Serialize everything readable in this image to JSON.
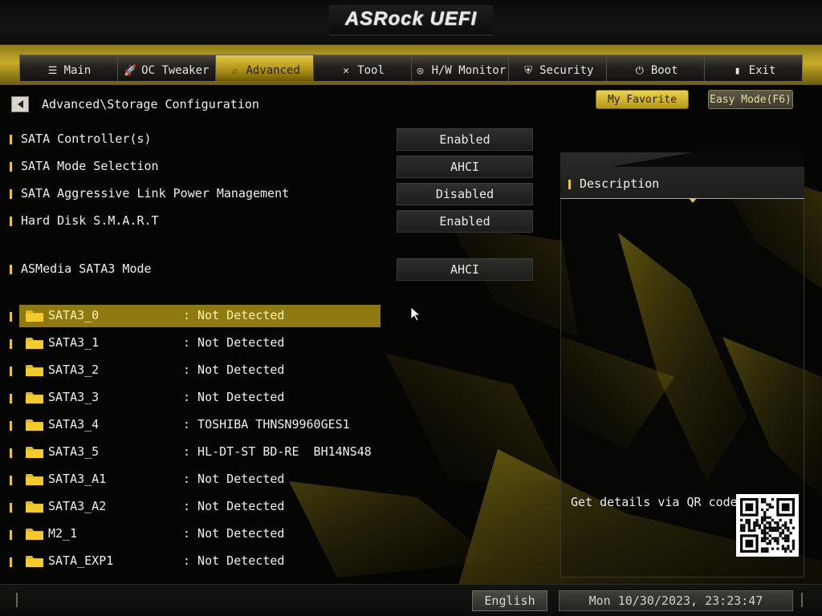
{
  "app": {
    "logo_text": "ASRock UEFI"
  },
  "tabs": [
    {
      "label": "Main",
      "icon": "list-icon",
      "active": false
    },
    {
      "label": "OC Tweaker",
      "icon": "rocket-icon",
      "active": false
    },
    {
      "label": "Advanced",
      "icon": "star-icon",
      "active": true
    },
    {
      "label": "Tool",
      "icon": "tools-icon",
      "active": false
    },
    {
      "label": "H/W Monitor",
      "icon": "monitor-icon",
      "active": false
    },
    {
      "label": "Security",
      "icon": "shield-icon",
      "active": false
    },
    {
      "label": "Boot",
      "icon": "power-icon",
      "active": false
    },
    {
      "label": "Exit",
      "icon": "exit-door-icon",
      "active": false
    }
  ],
  "breadcrumb": "Advanced\\Storage Configuration",
  "buttons": {
    "my_favorite": "My Favorite",
    "easy_mode": "Easy Mode(F6)"
  },
  "settings": [
    {
      "label": "SATA Controller(s)",
      "value": "Enabled"
    },
    {
      "label": "SATA Mode Selection",
      "value": "AHCI"
    },
    {
      "label": "SATA Aggressive Link Power Management",
      "value": "Disabled"
    },
    {
      "label": "Hard Disk S.M.A.R.T",
      "value": "Enabled"
    },
    {
      "label": "ASMedia SATA3 Mode",
      "value": "AHCI"
    }
  ],
  "devices": [
    {
      "name": "SATA3_0",
      "value": ": Not Detected",
      "selected": true
    },
    {
      "name": "SATA3_1",
      "value": ": Not Detected",
      "selected": false
    },
    {
      "name": "SATA3_2",
      "value": ": Not Detected",
      "selected": false
    },
    {
      "name": "SATA3_3",
      "value": ": Not Detected",
      "selected": false
    },
    {
      "name": "SATA3_4",
      "value": ": TOSHIBA THNSN9960GES1",
      "selected": false
    },
    {
      "name": "SATA3_5",
      "value": ": HL-DT-ST BD-RE  BH14NS48",
      "selected": false
    },
    {
      "name": "SATA3_A1",
      "value": ": Not Detected",
      "selected": false
    },
    {
      "name": "SATA3_A2",
      "value": ": Not Detected",
      "selected": false
    },
    {
      "name": "M2_1",
      "value": ": Not Detected",
      "selected": false
    },
    {
      "name": "SATA_EXP1",
      "value": ": Not Detected",
      "selected": false
    }
  ],
  "description": {
    "title": "Description",
    "qr_text": "Get details via QR code"
  },
  "footer": {
    "language": "English",
    "datetime": "Mon 10/30/2023, 23:23:47"
  },
  "colors": {
    "accent": "#e3c43a",
    "highlight": "#8f7a12",
    "background": "#050504"
  }
}
